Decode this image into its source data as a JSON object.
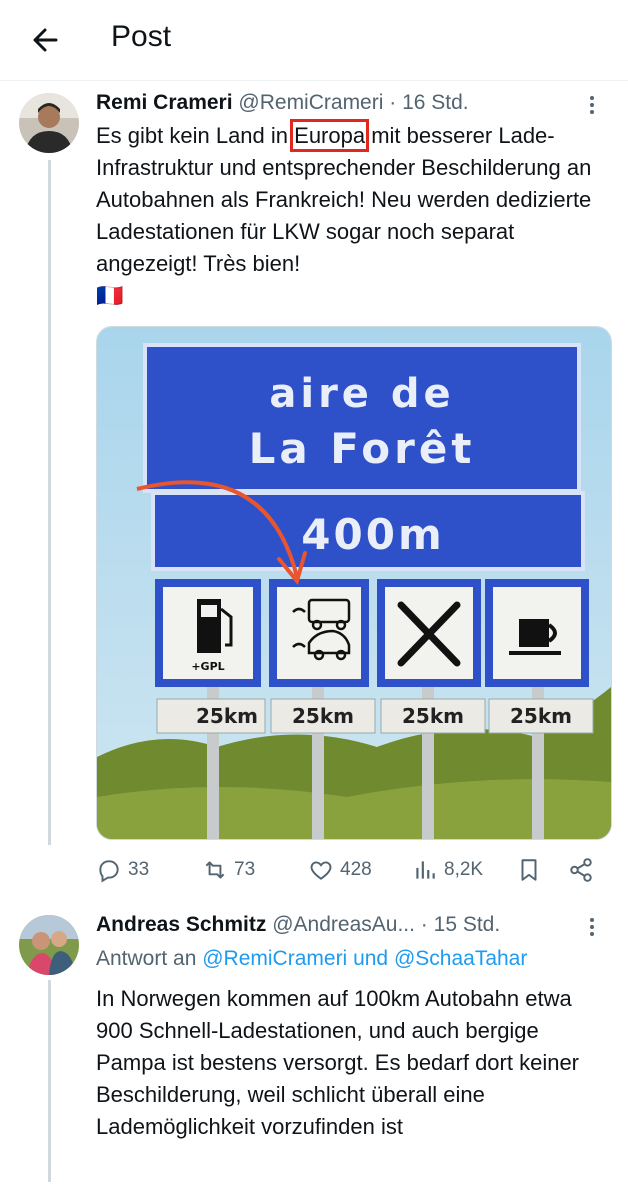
{
  "header": {
    "title": "Post"
  },
  "post": {
    "author_name": "Remi Crameri",
    "handle": "@RemiCrameri",
    "time_sep": " · ",
    "time": "16 Std.",
    "text_before": "Es gibt kein Land in ",
    "text_highlight": "Europa",
    "text_after": " mit besserer Lade-Infrastruktur und entsprechender Beschilderung an Autobahnen als Frankreich! Neu werden dedizierte Ladestationen für LKW sogar noch separat angezeigt! Très bien!",
    "flag": "🇫🇷",
    "image": {
      "sign_line1": "aire de",
      "sign_line2": "La Forêt",
      "distance": "400m",
      "services": [
        {
          "icon": "fuel-pump-icon",
          "sub": "+GPL",
          "km": "25km"
        },
        {
          "icon": "ev-charging-icon",
          "sub": "",
          "km": "25km"
        },
        {
          "icon": "restaurant-icon",
          "sub": "",
          "km": "25km"
        },
        {
          "icon": "cafe-icon",
          "sub": "",
          "km": "25km"
        }
      ]
    },
    "stats": {
      "replies": "33",
      "reposts": "73",
      "likes": "428",
      "views": "8,2K"
    }
  },
  "reply": {
    "author_name": "Andreas Schmitz",
    "handle": "@AndreasAu...",
    "time_sep": " · ",
    "time": "15 Std.",
    "reply_prefix": "Antwort an ",
    "mention1": "@RemiCrameri",
    "reply_and": " und ",
    "mention2": "@SchaaTahar",
    "text": "In Norwegen kommen auf 100km Autobahn etwa 900 Schnell-Ladestationen, und auch bergige Pampa ist bestens versorgt. Es bedarf dort keiner Beschilderung, weil schlicht überall eine Lademöglichkeit vorzufinden ist"
  },
  "colors": {
    "text": "#0f1419",
    "muted": "#536471",
    "link": "#1d9bf0",
    "sign_blue": "#2e51c9",
    "highlight": "#e0281e"
  }
}
